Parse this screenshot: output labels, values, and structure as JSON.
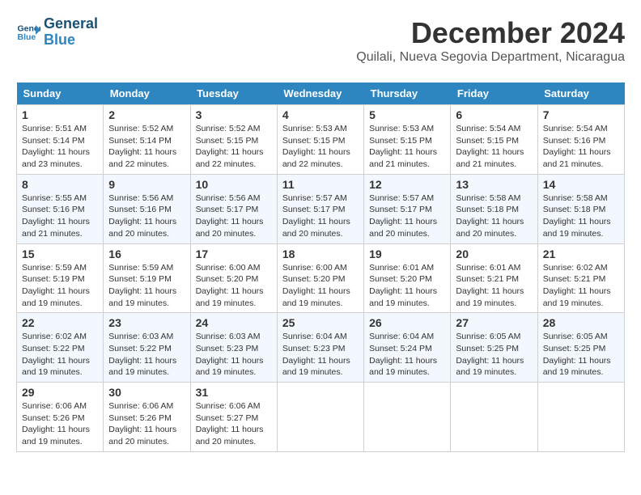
{
  "logo": {
    "line1": "General",
    "line2": "Blue"
  },
  "title": "December 2024",
  "location": "Quilali, Nueva Segovia Department, Nicaragua",
  "weekdays": [
    "Sunday",
    "Monday",
    "Tuesday",
    "Wednesday",
    "Thursday",
    "Friday",
    "Saturday"
  ],
  "weeks": [
    [
      {
        "day": "1",
        "sunrise": "Sunrise: 5:51 AM",
        "sunset": "Sunset: 5:14 PM",
        "daylight": "Daylight: 11 hours and 23 minutes."
      },
      {
        "day": "2",
        "sunrise": "Sunrise: 5:52 AM",
        "sunset": "Sunset: 5:14 PM",
        "daylight": "Daylight: 11 hours and 22 minutes."
      },
      {
        "day": "3",
        "sunrise": "Sunrise: 5:52 AM",
        "sunset": "Sunset: 5:15 PM",
        "daylight": "Daylight: 11 hours and 22 minutes."
      },
      {
        "day": "4",
        "sunrise": "Sunrise: 5:53 AM",
        "sunset": "Sunset: 5:15 PM",
        "daylight": "Daylight: 11 hours and 22 minutes."
      },
      {
        "day": "5",
        "sunrise": "Sunrise: 5:53 AM",
        "sunset": "Sunset: 5:15 PM",
        "daylight": "Daylight: 11 hours and 21 minutes."
      },
      {
        "day": "6",
        "sunrise": "Sunrise: 5:54 AM",
        "sunset": "Sunset: 5:15 PM",
        "daylight": "Daylight: 11 hours and 21 minutes."
      },
      {
        "day": "7",
        "sunrise": "Sunrise: 5:54 AM",
        "sunset": "Sunset: 5:16 PM",
        "daylight": "Daylight: 11 hours and 21 minutes."
      }
    ],
    [
      {
        "day": "8",
        "sunrise": "Sunrise: 5:55 AM",
        "sunset": "Sunset: 5:16 PM",
        "daylight": "Daylight: 11 hours and 21 minutes."
      },
      {
        "day": "9",
        "sunrise": "Sunrise: 5:56 AM",
        "sunset": "Sunset: 5:16 PM",
        "daylight": "Daylight: 11 hours and 20 minutes."
      },
      {
        "day": "10",
        "sunrise": "Sunrise: 5:56 AM",
        "sunset": "Sunset: 5:17 PM",
        "daylight": "Daylight: 11 hours and 20 minutes."
      },
      {
        "day": "11",
        "sunrise": "Sunrise: 5:57 AM",
        "sunset": "Sunset: 5:17 PM",
        "daylight": "Daylight: 11 hours and 20 minutes."
      },
      {
        "day": "12",
        "sunrise": "Sunrise: 5:57 AM",
        "sunset": "Sunset: 5:17 PM",
        "daylight": "Daylight: 11 hours and 20 minutes."
      },
      {
        "day": "13",
        "sunrise": "Sunrise: 5:58 AM",
        "sunset": "Sunset: 5:18 PM",
        "daylight": "Daylight: 11 hours and 20 minutes."
      },
      {
        "day": "14",
        "sunrise": "Sunrise: 5:58 AM",
        "sunset": "Sunset: 5:18 PM",
        "daylight": "Daylight: 11 hours and 19 minutes."
      }
    ],
    [
      {
        "day": "15",
        "sunrise": "Sunrise: 5:59 AM",
        "sunset": "Sunset: 5:19 PM",
        "daylight": "Daylight: 11 hours and 19 minutes."
      },
      {
        "day": "16",
        "sunrise": "Sunrise: 5:59 AM",
        "sunset": "Sunset: 5:19 PM",
        "daylight": "Daylight: 11 hours and 19 minutes."
      },
      {
        "day": "17",
        "sunrise": "Sunrise: 6:00 AM",
        "sunset": "Sunset: 5:20 PM",
        "daylight": "Daylight: 11 hours and 19 minutes."
      },
      {
        "day": "18",
        "sunrise": "Sunrise: 6:00 AM",
        "sunset": "Sunset: 5:20 PM",
        "daylight": "Daylight: 11 hours and 19 minutes."
      },
      {
        "day": "19",
        "sunrise": "Sunrise: 6:01 AM",
        "sunset": "Sunset: 5:20 PM",
        "daylight": "Daylight: 11 hours and 19 minutes."
      },
      {
        "day": "20",
        "sunrise": "Sunrise: 6:01 AM",
        "sunset": "Sunset: 5:21 PM",
        "daylight": "Daylight: 11 hours and 19 minutes."
      },
      {
        "day": "21",
        "sunrise": "Sunrise: 6:02 AM",
        "sunset": "Sunset: 5:21 PM",
        "daylight": "Daylight: 11 hours and 19 minutes."
      }
    ],
    [
      {
        "day": "22",
        "sunrise": "Sunrise: 6:02 AM",
        "sunset": "Sunset: 5:22 PM",
        "daylight": "Daylight: 11 hours and 19 minutes."
      },
      {
        "day": "23",
        "sunrise": "Sunrise: 6:03 AM",
        "sunset": "Sunset: 5:22 PM",
        "daylight": "Daylight: 11 hours and 19 minutes."
      },
      {
        "day": "24",
        "sunrise": "Sunrise: 6:03 AM",
        "sunset": "Sunset: 5:23 PM",
        "daylight": "Daylight: 11 hours and 19 minutes."
      },
      {
        "day": "25",
        "sunrise": "Sunrise: 6:04 AM",
        "sunset": "Sunset: 5:23 PM",
        "daylight": "Daylight: 11 hours and 19 minutes."
      },
      {
        "day": "26",
        "sunrise": "Sunrise: 6:04 AM",
        "sunset": "Sunset: 5:24 PM",
        "daylight": "Daylight: 11 hours and 19 minutes."
      },
      {
        "day": "27",
        "sunrise": "Sunrise: 6:05 AM",
        "sunset": "Sunset: 5:25 PM",
        "daylight": "Daylight: 11 hours and 19 minutes."
      },
      {
        "day": "28",
        "sunrise": "Sunrise: 6:05 AM",
        "sunset": "Sunset: 5:25 PM",
        "daylight": "Daylight: 11 hours and 19 minutes."
      }
    ],
    [
      {
        "day": "29",
        "sunrise": "Sunrise: 6:06 AM",
        "sunset": "Sunset: 5:26 PM",
        "daylight": "Daylight: 11 hours and 19 minutes."
      },
      {
        "day": "30",
        "sunrise": "Sunrise: 6:06 AM",
        "sunset": "Sunset: 5:26 PM",
        "daylight": "Daylight: 11 hours and 20 minutes."
      },
      {
        "day": "31",
        "sunrise": "Sunrise: 6:06 AM",
        "sunset": "Sunset: 5:27 PM",
        "daylight": "Daylight: 11 hours and 20 minutes."
      },
      null,
      null,
      null,
      null
    ]
  ]
}
